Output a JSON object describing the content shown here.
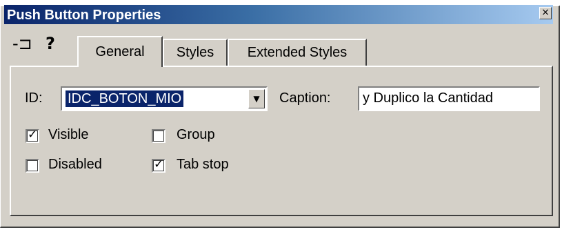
{
  "window": {
    "title": "Push Button Properties",
    "close_glyph": "×"
  },
  "toolbar": {
    "pin_icon": "pin-icon",
    "help_icon": "help-icon",
    "pin_glyph": "-⊐",
    "help_glyph": "?"
  },
  "tabs": [
    {
      "label": "General",
      "active": true
    },
    {
      "label": "Styles",
      "active": false
    },
    {
      "label": "Extended Styles",
      "active": false
    }
  ],
  "general": {
    "id_label": "ID:",
    "id_value": "IDC_BOTON_MIO",
    "dropdown_glyph": "▼",
    "caption_label": "Caption:",
    "caption_value": "y Duplico la Cantidad",
    "checkboxes": [
      {
        "label": "Visible",
        "checked": true
      },
      {
        "label": "Group",
        "checked": false
      },
      {
        "label": "Disabled",
        "checked": false
      },
      {
        "label": "Tab stop",
        "checked": true
      }
    ],
    "check_glyph": "✓"
  },
  "colors": {
    "title_start": "#0a246a",
    "title_end": "#a6caf0",
    "selection": "#0a246a",
    "face": "#d4d0c8"
  }
}
